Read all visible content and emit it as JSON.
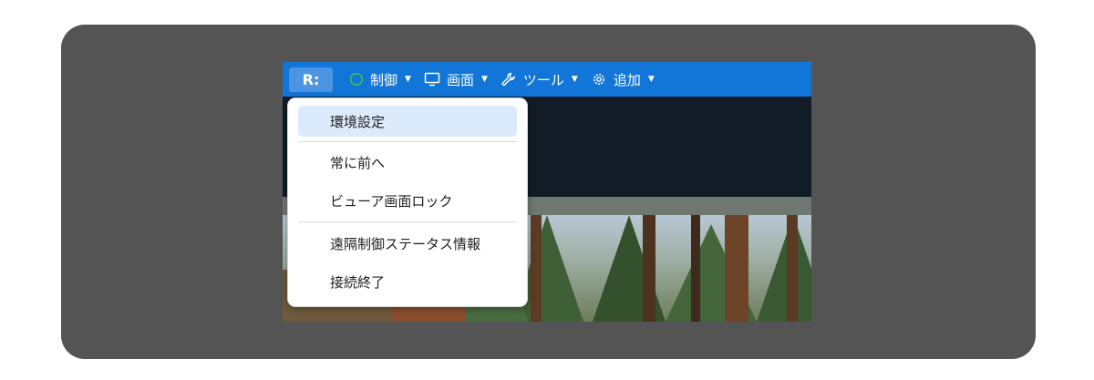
{
  "toolbar": {
    "logo": "R:",
    "items": [
      {
        "label": "制御",
        "icon": "circle-icon"
      },
      {
        "label": "画面",
        "icon": "monitor-icon"
      },
      {
        "label": "ツール",
        "icon": "wrench-icon"
      },
      {
        "label": "追加",
        "icon": "gear-icon"
      }
    ],
    "caret": "▼"
  },
  "menu": {
    "items": [
      {
        "label": "環境設定",
        "selected": true
      },
      {
        "label": "常に前へ"
      },
      {
        "label": "ビューア画面ロック"
      },
      {
        "label": "遠隔制御ステータス情報"
      },
      {
        "label": "接続終了"
      }
    ]
  },
  "colors": {
    "toolbar": "#1275d8",
    "logo_button": "#4c95e3",
    "frame": "#545454",
    "selected_item": "#dcebfb",
    "status_circle": "#3ac24f"
  }
}
